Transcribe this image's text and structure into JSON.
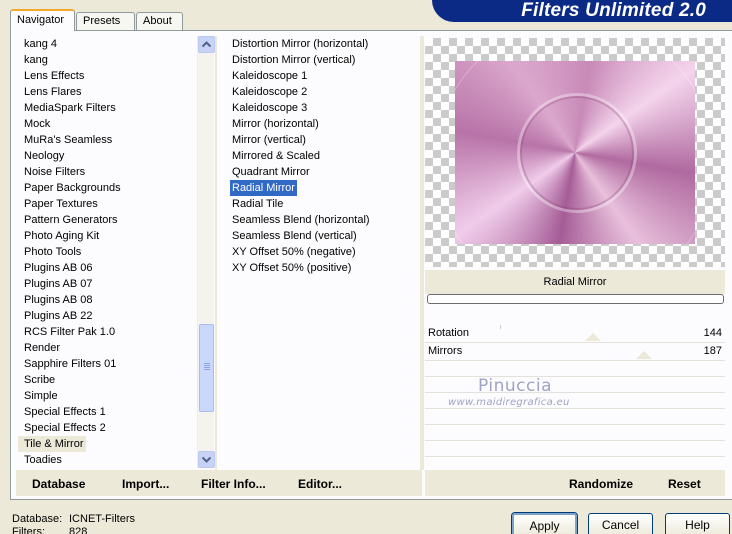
{
  "app": {
    "title": "Filters Unlimited 2.0"
  },
  "tabs": [
    {
      "label": "Navigator",
      "active": true
    },
    {
      "label": "Presets",
      "active": false
    },
    {
      "label": "About",
      "active": false
    }
  ],
  "categories": {
    "items": [
      "kang 4",
      "kang",
      "Lens Effects",
      "Lens Flares",
      "MediaSpark Filters",
      "Mock",
      "MuRa's Seamless",
      "Neology",
      "Noise Filters",
      "Paper Backgrounds",
      "Paper Textures",
      "Pattern Generators",
      "Photo Aging Kit",
      "Photo Tools",
      "Plugins AB 06",
      "Plugins AB 07",
      "Plugins AB 08",
      "Plugins AB 22",
      "RCS Filter Pak 1.0",
      "Render",
      "Sapphire Filters 01",
      "Scribe",
      "Simple",
      "Special Effects 1",
      "Special Effects 2",
      "Tile & Mirror",
      "Toadies"
    ],
    "selected": "Tile & Mirror"
  },
  "filters": {
    "items": [
      "Distortion Mirror (horizontal)",
      "Distortion Mirror (vertical)",
      "Kaleidoscope 1",
      "Kaleidoscope 2",
      "Kaleidoscope 3",
      "Mirror (horizontal)",
      "Mirror (vertical)",
      "Mirrored & Scaled",
      "Quadrant Mirror",
      "Radial Mirror",
      "Radial Tile",
      "Seamless Blend (horizontal)",
      "Seamless Blend (vertical)",
      "XY Offset 50% (negative)",
      "XY Offset 50% (positive)"
    ],
    "selected": "Radial Mirror"
  },
  "preview": {
    "filter_name": "Radial Mirror",
    "watermark_name": "Pinuccia",
    "watermark_url": "www.maidiregrafica.eu"
  },
  "parameters": [
    {
      "label": "Rotation",
      "value": "144"
    },
    {
      "label": "Mirrors",
      "value": "187"
    }
  ],
  "toolbar": {
    "database": "Database",
    "import": "Import...",
    "filter_info": "Filter Info...",
    "editor": "Editor...",
    "randomize": "Randomize",
    "reset": "Reset"
  },
  "status": {
    "database_label": "Database:",
    "database_value": "ICNET-Filters",
    "filters_label": "Filters:",
    "filters_value": "828"
  },
  "buttons": {
    "apply": "Apply",
    "cancel": "Cancel",
    "help": "Help"
  },
  "colors": {
    "banner": "#0a2a86",
    "selection": "#316ac5",
    "window_bg": "#ece9d8"
  }
}
